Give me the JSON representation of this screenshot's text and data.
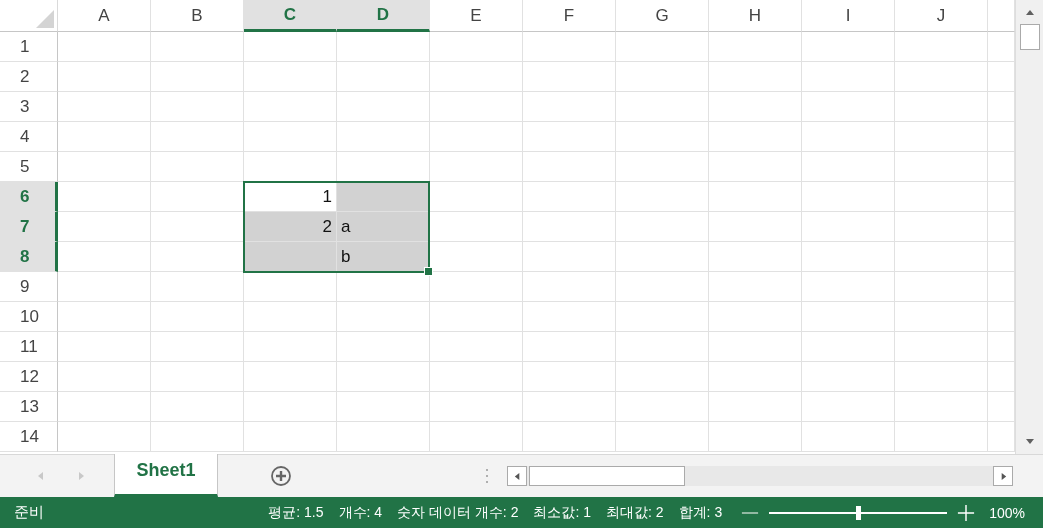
{
  "grid": {
    "columns": [
      {
        "label": "A",
        "selected": false
      },
      {
        "label": "B",
        "selected": false
      },
      {
        "label": "C",
        "selected": true
      },
      {
        "label": "D",
        "selected": true
      },
      {
        "label": "E",
        "selected": false
      },
      {
        "label": "F",
        "selected": false
      },
      {
        "label": "G",
        "selected": false
      },
      {
        "label": "H",
        "selected": false
      },
      {
        "label": "I",
        "selected": false
      },
      {
        "label": "J",
        "selected": false
      }
    ],
    "rows": [
      {
        "label": "1",
        "selected": false
      },
      {
        "label": "2",
        "selected": false
      },
      {
        "label": "3",
        "selected": false
      },
      {
        "label": "4",
        "selected": false
      },
      {
        "label": "5",
        "selected": false
      },
      {
        "label": "6",
        "selected": true,
        "cells": [
          {
            "selected": false
          },
          {
            "selected": false
          },
          {
            "text": "1",
            "kind": "number",
            "selected": false
          },
          {
            "selected": true
          }
        ]
      },
      {
        "label": "7",
        "selected": true,
        "cells": [
          {
            "selected": false
          },
          {
            "selected": false
          },
          {
            "text": "2",
            "kind": "number",
            "selected": true
          },
          {
            "text": "a",
            "kind": "text",
            "selected": true
          }
        ]
      },
      {
        "label": "8",
        "selected": true,
        "cells": [
          {
            "selected": false
          },
          {
            "selected": false
          },
          {
            "selected": true
          },
          {
            "text": "b",
            "kind": "text",
            "selected": true
          }
        ]
      },
      {
        "label": "9",
        "selected": false
      },
      {
        "label": "10",
        "selected": false
      },
      {
        "label": "11",
        "selected": false
      },
      {
        "label": "12",
        "selected": false
      },
      {
        "label": "13",
        "selected": false
      },
      {
        "label": "14",
        "selected": false
      }
    ]
  },
  "sheet_tabs": [
    {
      "label": "Sheet1",
      "selected": true
    }
  ],
  "status_bar": {
    "mode": "준비",
    "stats": [
      "평균: 1.5",
      "개수: 4",
      "숫자 데이터 개수: 2",
      "최소값: 1",
      "최대값: 2",
      "합계: 3"
    ],
    "zoom": {
      "level": 0.5,
      "reading": "100%"
    }
  }
}
